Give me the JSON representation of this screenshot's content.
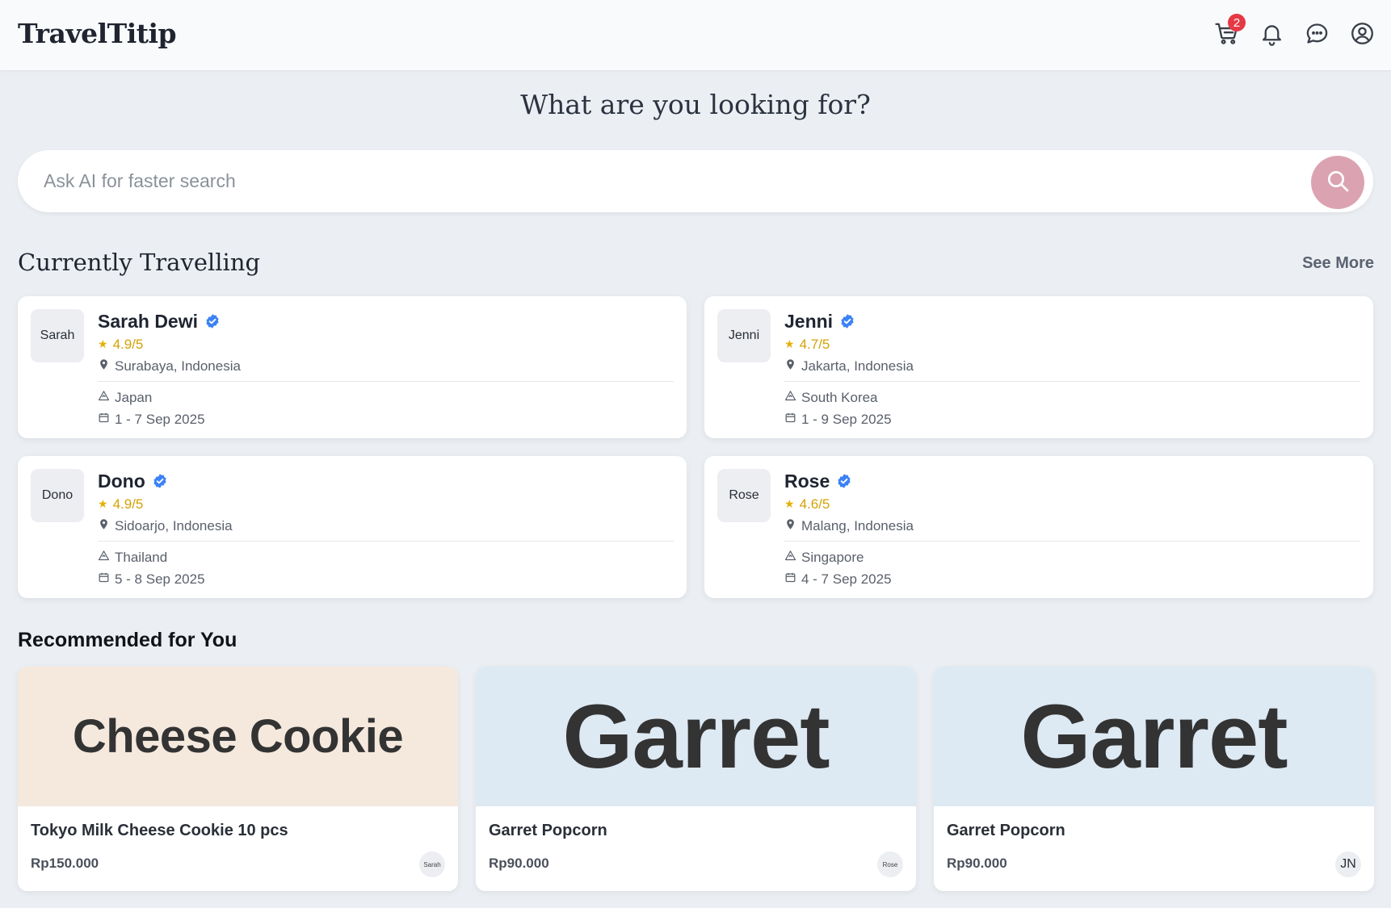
{
  "app": {
    "brand": "TravelTitip"
  },
  "header": {
    "cart_badge": "2",
    "icons": [
      "cart-icon",
      "bell-icon",
      "chat-icon",
      "user-icon"
    ]
  },
  "hero": {
    "headline": "What are you looking for?"
  },
  "search": {
    "placeholder": "Ask AI for faster search",
    "value": "",
    "button_color": "#dba3b2"
  },
  "travelling": {
    "title": "Currently Travelling",
    "see_more": "See More",
    "travelers": [
      {
        "avatar": "Sarah",
        "name": "Sarah Dewi",
        "rating": "4.9/5",
        "origin": "Surabaya, Indonesia",
        "destination": "Japan",
        "dates": "1 - 7 Sep 2025"
      },
      {
        "avatar": "Jenni",
        "name": "Jenni",
        "rating": "4.7/5",
        "origin": "Jakarta, Indonesia",
        "destination": "South Korea",
        "dates": "1 - 9 Sep 2025"
      },
      {
        "avatar": "Dono",
        "name": "Dono",
        "rating": "4.9/5",
        "origin": "Sidoarjo, Indonesia",
        "destination": "Thailand",
        "dates": "5 - 8 Sep 2025"
      },
      {
        "avatar": "Rose",
        "name": "Rose",
        "rating": "4.6/5",
        "origin": "Malang, Indonesia",
        "destination": "Singapore",
        "dates": "4 - 7 Sep 2025"
      }
    ]
  },
  "recommended": {
    "title": "Recommended for You",
    "products": [
      {
        "image_text": "Cheese Cookie",
        "name": "Tokyo Milk Cheese Cookie 10 pcs",
        "price": "Rp150.000",
        "seller": "Sarah"
      },
      {
        "image_text": "Garret",
        "name": "Garret Popcorn",
        "price": "Rp90.000",
        "seller": "Rose"
      },
      {
        "image_text": "Garret",
        "name": "Garret Popcorn",
        "price": "Rp90.000",
        "seller": "JN"
      }
    ]
  },
  "colors": {
    "star": "#e4b007",
    "verified": "#3b82f6",
    "badge": "#e53945"
  }
}
